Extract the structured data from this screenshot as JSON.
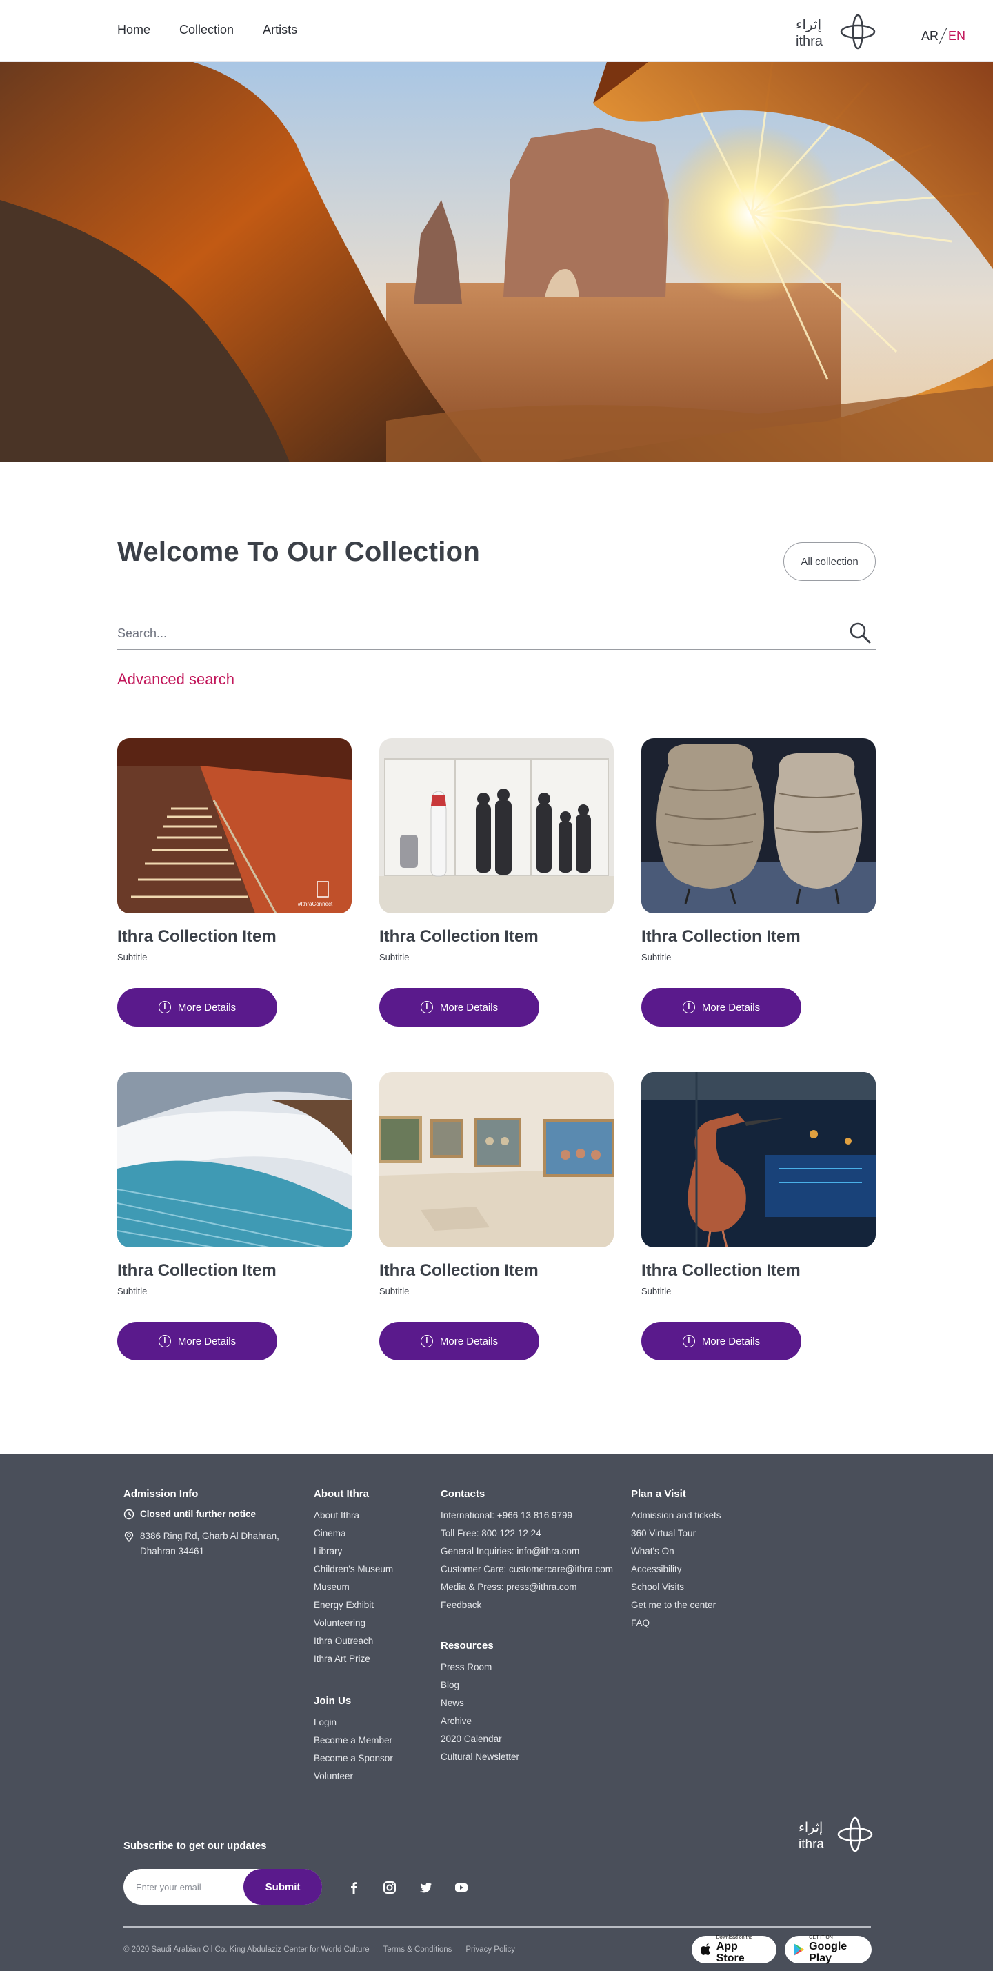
{
  "header": {
    "nav": [
      "Home",
      "Collection",
      "Artists"
    ],
    "logo_text_ar": "إثراء",
    "logo_text_en": "ithra",
    "lang_ar": "AR",
    "lang_en": "EN"
  },
  "welcome": {
    "title": "Welcome To Our Collection",
    "all_collection": "All collection",
    "search_placeholder": "Search...",
    "advanced_search": "Advanced search"
  },
  "cards": [
    {
      "title": "Ithra Collection Item",
      "subtitle": "Subtitle",
      "button": "More Details",
      "watermark": "#IthraConnect"
    },
    {
      "title": "Ithra Collection Item",
      "subtitle": "Subtitle",
      "button": "More Details"
    },
    {
      "title": "Ithra Collection Item",
      "subtitle": "Subtitle",
      "button": "More Details"
    },
    {
      "title": "Ithra Collection Item",
      "subtitle": "Subtitle",
      "button": "More Details"
    },
    {
      "title": "Ithra Collection Item",
      "subtitle": "Subtitle",
      "button": "More Details"
    },
    {
      "title": "Ithra Collection Item",
      "subtitle": "Subtitle",
      "button": "More Details"
    }
  ],
  "footer": {
    "admission": {
      "heading": "Admission Info",
      "status": "Closed until further notice",
      "address": "8386 Ring Rd, Gharb Al Dhahran, Dhahran 34461"
    },
    "about": {
      "heading": "About Ithra",
      "links": [
        "About Ithra",
        "Cinema",
        "Library",
        "Children's Museum",
        "Museum",
        "Energy Exhibit",
        "Volunteering",
        "Ithra Outreach",
        "Ithra Art Prize"
      ]
    },
    "join": {
      "heading": "Join Us",
      "links": [
        "Login",
        "Become a Member",
        "Become a Sponsor",
        "Volunteer"
      ]
    },
    "contacts": {
      "heading": "Contacts",
      "links": [
        "International: +966 13 816 9799",
        "Toll Free: 800 122 12 24",
        "General Inquiries: info@ithra.com",
        "Customer Care: customercare@ithra.com",
        "Media & Press: press@ithra.com",
        "Feedback"
      ]
    },
    "resources": {
      "heading": "Resources",
      "links": [
        "Press Room",
        "Blog",
        "News",
        "Archive",
        "2020 Calendar",
        "Cultural Newsletter"
      ]
    },
    "plan": {
      "heading": "Plan a Visit",
      "links": [
        "Admission and tickets",
        "360 Virtual Tour",
        "What's On",
        "Accessibility",
        "School Visits",
        "Get me to the center",
        "FAQ"
      ]
    },
    "subscribe": {
      "heading": "Subscribe to get our updates",
      "placeholder": "Enter your email",
      "button": "Submit"
    },
    "socials": [
      "facebook-icon",
      "instagram-icon",
      "twitter-icon",
      "youtube-icon"
    ],
    "copyright": "© 2020 Saudi Arabian Oil Co. King Abdulaziz Center for World Culture",
    "terms": "Terms & Conditions",
    "privacy": "Privacy Policy",
    "appstore_small": "Download on the",
    "appstore_big": "App Store",
    "gplay_small": "GET IT ON",
    "gplay_big": "Google Play"
  },
  "colors": {
    "accent": "#5a1a8c",
    "link_pink": "#c2185b",
    "footer_bg": "#4a4f5a"
  }
}
